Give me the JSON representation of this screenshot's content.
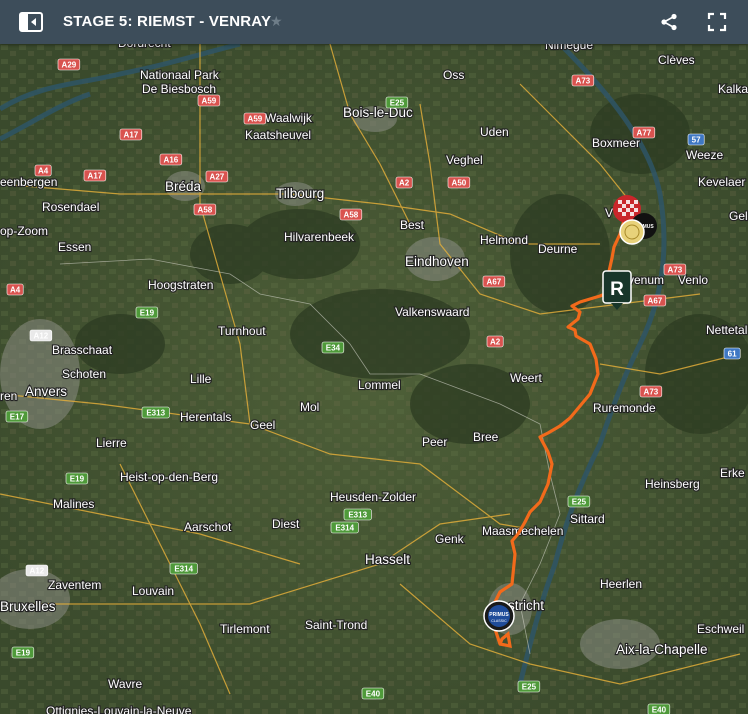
{
  "header": {
    "title": "STAGE 5: RIEMST - VENRAY",
    "star": "★"
  },
  "colors": {
    "topbar": "#3d4d5a",
    "route": "#f26a1b",
    "road_red": "#d9534f",
    "road_green": "#4f9a3a",
    "road_blue": "#3f78c4"
  },
  "icons": {
    "sidebar": "sidebar-toggle-icon",
    "share": "share-icon",
    "fullscreen": "fullscreen-icon"
  },
  "markers": {
    "finish_badge": "R",
    "sponsor_line1": "PRIMUS",
    "sponsor_line2": "CLASSIC"
  },
  "places": [
    {
      "name": "Dordrecht",
      "cls": "lbl"
    },
    {
      "name": "Nationaal Park",
      "cls": "lbl"
    },
    {
      "name": "De Biesbosch",
      "cls": "lbl"
    },
    {
      "name": "Oss",
      "cls": "lbl"
    },
    {
      "name": "Nimègue",
      "cls": "lbl"
    },
    {
      "name": "Clèves",
      "cls": "lbl"
    },
    {
      "name": "Kalka",
      "cls": "lbl"
    },
    {
      "name": "Waalwijk",
      "cls": "lbl"
    },
    {
      "name": "Kaatsheuvel",
      "cls": "lbl"
    },
    {
      "name": "Bois-le-Duc",
      "cls": "lbl big"
    },
    {
      "name": "Uden",
      "cls": "lbl"
    },
    {
      "name": "Boxmeer",
      "cls": "lbl"
    },
    {
      "name": "Weeze",
      "cls": "lbl"
    },
    {
      "name": "Kevelaer",
      "cls": "lbl"
    },
    {
      "name": "Veghel",
      "cls": "lbl"
    },
    {
      "name": "eenbergen",
      "cls": "lbl"
    },
    {
      "name": "Bréda",
      "cls": "lbl big"
    },
    {
      "name": "Tilbourg",
      "cls": "lbl big"
    },
    {
      "name": "Rosendael",
      "cls": "lbl"
    },
    {
      "name": "Best",
      "cls": "lbl"
    },
    {
      "name": "Helmond",
      "cls": "lbl"
    },
    {
      "name": "Deurne",
      "cls": "lbl"
    },
    {
      "name": "Gel",
      "cls": "lbl"
    },
    {
      "name": "op-Zoom",
      "cls": "lbl"
    },
    {
      "name": "Essen",
      "cls": "lbl"
    },
    {
      "name": "Hilvarenbeek",
      "cls": "lbl"
    },
    {
      "name": "Eindhoven",
      "cls": "lbl big"
    },
    {
      "name": "venum",
      "cls": "lbl"
    },
    {
      "name": "Venlo",
      "cls": "lbl"
    },
    {
      "name": "Hoogstraten",
      "cls": "lbl"
    },
    {
      "name": "Valkenswaard",
      "cls": "lbl"
    },
    {
      "name": "Nettetal",
      "cls": "lbl"
    },
    {
      "name": "Turnhout",
      "cls": "lbl"
    },
    {
      "name": "Brasschaat",
      "cls": "lbl"
    },
    {
      "name": "Schoten",
      "cls": "lbl"
    },
    {
      "name": "Anvers",
      "cls": "lbl big"
    },
    {
      "name": "Lille",
      "cls": "lbl"
    },
    {
      "name": "Lommel",
      "cls": "lbl"
    },
    {
      "name": "Weert",
      "cls": "lbl"
    },
    {
      "name": "Ruremonde",
      "cls": "lbl"
    },
    {
      "name": "Herentals",
      "cls": "lbl"
    },
    {
      "name": "Geel",
      "cls": "lbl"
    },
    {
      "name": "Mol",
      "cls": "lbl"
    },
    {
      "name": "Lierre",
      "cls": "lbl"
    },
    {
      "name": "Peer",
      "cls": "lbl"
    },
    {
      "name": "Bree",
      "cls": "lbl"
    },
    {
      "name": "Heist-op-den-Berg",
      "cls": "lbl"
    },
    {
      "name": "Erke",
      "cls": "lbl"
    },
    {
      "name": "Heinsberg",
      "cls": "lbl"
    },
    {
      "name": "Malines",
      "cls": "lbl"
    },
    {
      "name": "Heusden-Zolder",
      "cls": "lbl"
    },
    {
      "name": "Aarschot",
      "cls": "lbl"
    },
    {
      "name": "Diest",
      "cls": "lbl"
    },
    {
      "name": "Sittard",
      "cls": "lbl"
    },
    {
      "name": "Genk",
      "cls": "lbl"
    },
    {
      "name": "Maasmechelen",
      "cls": "lbl"
    },
    {
      "name": "Hasselt",
      "cls": "lbl big"
    },
    {
      "name": "Heerlen",
      "cls": "lbl"
    },
    {
      "name": "Zaventem",
      "cls": "lbl"
    },
    {
      "name": "Louvain",
      "cls": "lbl"
    },
    {
      "name": "Bruxelles",
      "cls": "lbl big"
    },
    {
      "name": "stricht",
      "cls": "lbl big"
    },
    {
      "name": "Tirlemont",
      "cls": "lbl"
    },
    {
      "name": "Saint-Trond",
      "cls": "lbl"
    },
    {
      "name": "Eschweil",
      "cls": "lbl"
    },
    {
      "name": "Aix-la-Chapelle",
      "cls": "lbl big"
    },
    {
      "name": "Wavre",
      "cls": "lbl"
    },
    {
      "name": "Ottignies-Louvain-la-Neuve",
      "cls": "lbl"
    },
    {
      "name": "ren",
      "cls": "lbl"
    },
    {
      "name": "V",
      "cls": "lbl"
    }
  ],
  "roads": [
    {
      "ref": "A29",
      "kind": "red"
    },
    {
      "ref": "A59",
      "kind": "red"
    },
    {
      "ref": "A59",
      "kind": "red"
    },
    {
      "ref": "A17",
      "kind": "red"
    },
    {
      "ref": "A16",
      "kind": "red"
    },
    {
      "ref": "A4",
      "kind": "red"
    },
    {
      "ref": "A17",
      "kind": "red"
    },
    {
      "ref": "A27",
      "kind": "red"
    },
    {
      "ref": "A58",
      "kind": "red"
    },
    {
      "ref": "A58",
      "kind": "red"
    },
    {
      "ref": "A2",
      "kind": "red"
    },
    {
      "ref": "A50",
      "kind": "red"
    },
    {
      "ref": "A73",
      "kind": "red"
    },
    {
      "ref": "A77",
      "kind": "red"
    },
    {
      "ref": "57",
      "kind": "blue"
    },
    {
      "ref": "E25",
      "kind": "green"
    },
    {
      "ref": "A4",
      "kind": "red"
    },
    {
      "ref": "A67",
      "kind": "red"
    },
    {
      "ref": "A73",
      "kind": "red"
    },
    {
      "ref": "A67",
      "kind": "red"
    },
    {
      "ref": "A12",
      "kind": "white"
    },
    {
      "ref": "E19",
      "kind": "green"
    },
    {
      "ref": "E34",
      "kind": "green"
    },
    {
      "ref": "A2",
      "kind": "red"
    },
    {
      "ref": "61",
      "kind": "blue"
    },
    {
      "ref": "A73",
      "kind": "red"
    },
    {
      "ref": "E17",
      "kind": "green"
    },
    {
      "ref": "E313",
      "kind": "green"
    },
    {
      "ref": "E19",
      "kind": "green"
    },
    {
      "ref": "E25",
      "kind": "green"
    },
    {
      "ref": "E313",
      "kind": "green"
    },
    {
      "ref": "E314",
      "kind": "green"
    },
    {
      "ref": "A12",
      "kind": "white"
    },
    {
      "ref": "E314",
      "kind": "green"
    },
    {
      "ref": "E19",
      "kind": "green"
    },
    {
      "ref": "E40",
      "kind": "green"
    },
    {
      "ref": "E25",
      "kind": "green"
    },
    {
      "ref": "E40",
      "kind": "green"
    }
  ]
}
